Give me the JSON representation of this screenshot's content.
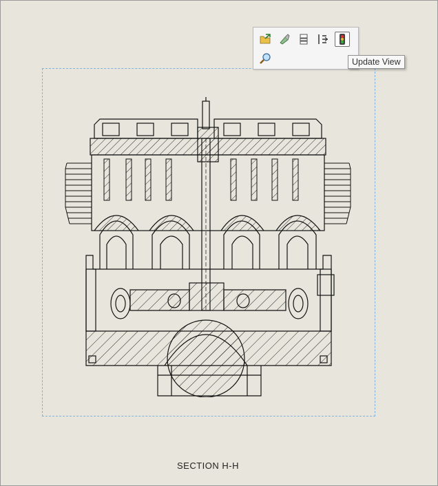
{
  "view": {
    "caption": "SECTION H-H"
  },
  "toolbar": {
    "buttons": [
      {
        "icon": "open-drawing-view-icon",
        "label": "Open"
      },
      {
        "icon": "hide-show-icon",
        "label": "Hide/Show"
      },
      {
        "icon": "component-properties-icon",
        "label": "Properties"
      },
      {
        "icon": "align-view-icon",
        "label": "Alignment"
      },
      {
        "icon": "update-view-traffic-light-icon",
        "label": "Update View"
      },
      {
        "icon": "zoom-to-selection-icon",
        "label": "Zoom"
      }
    ]
  },
  "tooltip": {
    "text": "Update View"
  },
  "colors": {
    "sheet_background": "#e8e6dc",
    "view_boundary": "#7fb0e0",
    "line_color": "#111111"
  }
}
